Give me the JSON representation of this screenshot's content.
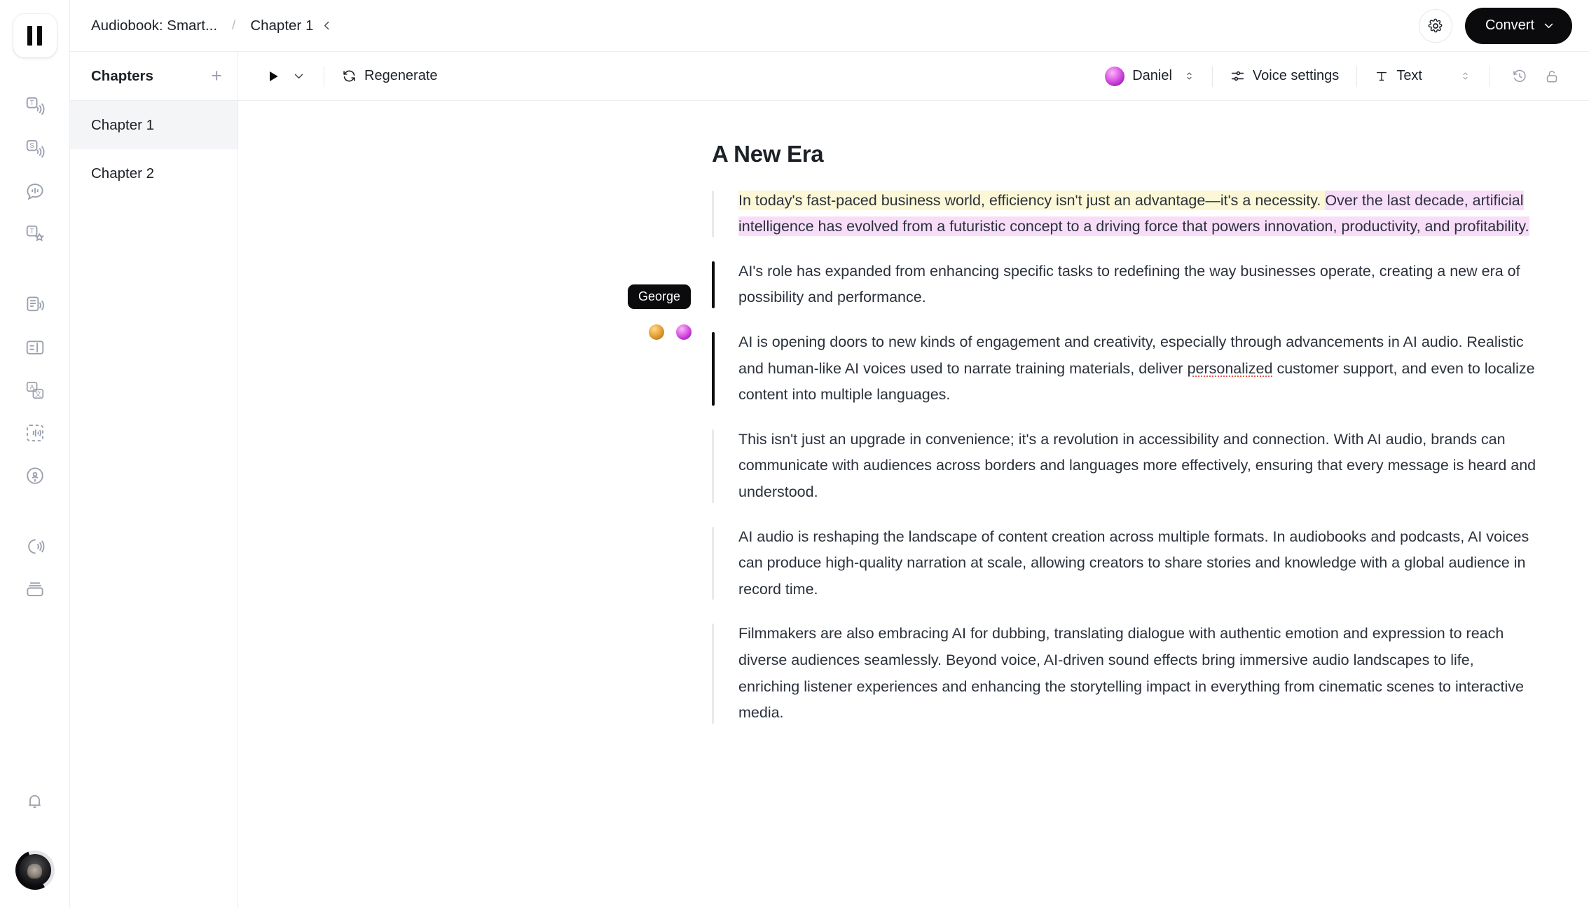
{
  "rail": {
    "pause_button_label": "Pause",
    "icons_group1": [
      {
        "name": "text-to-speech-icon",
        "label": "Text to Speech"
      },
      {
        "name": "speech-to-speech-icon",
        "label": "Speech to Speech"
      },
      {
        "name": "voice-chat-icon",
        "label": "Voice Chat"
      },
      {
        "name": "text-to-sfx-icon",
        "label": "Sound Effects"
      }
    ],
    "icons_group2": [
      {
        "name": "document-audio-icon",
        "label": "Studio"
      },
      {
        "name": "audio-editor-icon",
        "label": "Audio Editor"
      },
      {
        "name": "translate-dub-icon",
        "label": "Dubbing"
      },
      {
        "name": "voice-isolator-icon",
        "label": "Voice Isolator"
      },
      {
        "name": "podcast-icon",
        "label": "Podcast"
      }
    ],
    "icons_group3": [
      {
        "name": "voice-library-icon",
        "label": "Voices"
      },
      {
        "name": "cards-stack-icon",
        "label": "Projects"
      }
    ],
    "notifications_label": "Notifications",
    "account_label": "Account"
  },
  "header": {
    "breadcrumb_root": "Audiobook: Smart...",
    "breadcrumb_separator": "/",
    "breadcrumb_current": "Chapter 1",
    "settings_label": "Settings",
    "convert_label": "Convert"
  },
  "chapters": {
    "title": "Chapters",
    "add_label": "+",
    "items": [
      {
        "label": "Chapter 1",
        "active": true
      },
      {
        "label": "Chapter 2",
        "active": false
      }
    ]
  },
  "toolbar": {
    "play_label": "Play",
    "regenerate_label": "Regenerate",
    "voice_name": "Daniel",
    "voice_settings_label": "Voice settings",
    "text_label": "Text",
    "history_label": "History",
    "lock_label": "Unlocked"
  },
  "document": {
    "title": "A New Era",
    "speaker_tooltip": "George",
    "speakers": [
      {
        "name": "speaker-avatar-gold"
      },
      {
        "name": "speaker-avatar-magenta"
      }
    ],
    "paragraphs": [
      {
        "id": "p1",
        "active": false,
        "highlighted": true,
        "highlight_yellow": "In today's fast-paced business world, efficiency isn't just an advantage—it's a necessity. ",
        "highlight_pink": "Over the last decade, artificial intelligence has evolved from a futuristic concept to a driving force that powers innovation, productivity, and profitability."
      },
      {
        "id": "p2",
        "active": true,
        "text": "AI's role has expanded from enhancing specific tasks to redefining the way businesses operate, creating a new era of possibility and performance."
      },
      {
        "id": "p3",
        "active": true,
        "text_before": "AI is opening doors to new kinds of engagement and creativity, especially through advancements in AI audio. Realistic and human-like AI voices used to narrate training materials, deliver ",
        "misspelled_word": "personalized",
        "text_after": " customer support, and even to localize content into multiple languages."
      },
      {
        "id": "p4",
        "active": false,
        "text": "This isn't just an upgrade in convenience; it's a revolution in accessibility and connection. With AI audio, brands can communicate with audiences across borders and languages more effectively, ensuring that every message is heard and understood."
      },
      {
        "id": "p5",
        "active": false,
        "text": "AI audio is reshaping the landscape of content creation across multiple formats. In audiobooks and podcasts, AI voices can produce high-quality narration at scale, allowing creators to share stories and knowledge with a global audience in record time."
      },
      {
        "id": "p6",
        "active": false,
        "text": "Filmmakers are also embracing AI for dubbing, translating dialogue with authentic emotion and expression to reach diverse audiences seamlessly. Beyond voice, AI-driven sound effects bring immersive audio landscapes to life, enriching listener experiences and enhancing the storytelling impact in everything from cinematic scenes to interactive media."
      }
    ]
  },
  "colors": {
    "accent_dark": "#0b0b0d",
    "highlight_yellow": "#fcf8d7",
    "highlight_pink": "#f8ddf8",
    "border": "#ededef",
    "muted_icon": "#9aa0ad",
    "spellcheck_red": "#e8594a"
  }
}
